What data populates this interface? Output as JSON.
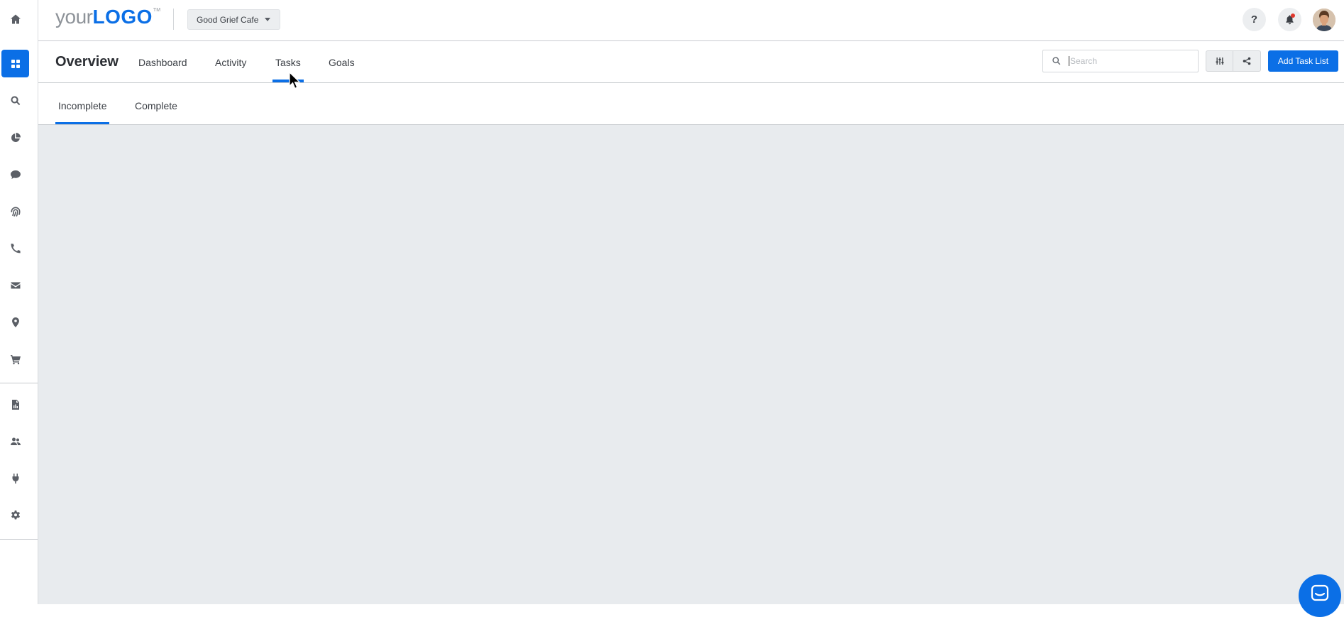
{
  "topbar": {
    "logo": {
      "your": "your",
      "logo": "LOGO",
      "tm": "TM"
    },
    "business_select": "Good Grief Cafe",
    "help_label": "?",
    "icons": [
      "question-icon",
      "bell-icon",
      "avatar"
    ]
  },
  "rail": {
    "items": [
      {
        "name": "home-icon"
      },
      {
        "name": "dashboard-grid-icon",
        "active": true
      },
      {
        "name": "search-icon"
      },
      {
        "name": "pie-chart-icon"
      },
      {
        "name": "chat-icon"
      },
      {
        "name": "fingerprint-icon"
      },
      {
        "name": "phone-icon"
      },
      {
        "name": "envelope-icon"
      },
      {
        "name": "map-pin-icon"
      },
      {
        "name": "cart-icon"
      },
      {
        "name": "report-file-icon"
      },
      {
        "name": "users-icon"
      },
      {
        "name": "plug-icon"
      },
      {
        "name": "gear-icon"
      }
    ]
  },
  "nav": {
    "title": "Overview",
    "tabs": [
      {
        "label": "Dashboard"
      },
      {
        "label": "Activity"
      },
      {
        "label": "Tasks",
        "active": true
      },
      {
        "label": "Goals"
      }
    ],
    "search_placeholder": "Search",
    "add_button": "Add Task List"
  },
  "subtabs": {
    "tabs": [
      {
        "label": "Incomplete",
        "active": true
      },
      {
        "label": "Complete"
      }
    ]
  },
  "colors": {
    "accent": "#0b6fe6",
    "content_bg": "#e8ebee",
    "notification_dot": "#e0362c"
  }
}
